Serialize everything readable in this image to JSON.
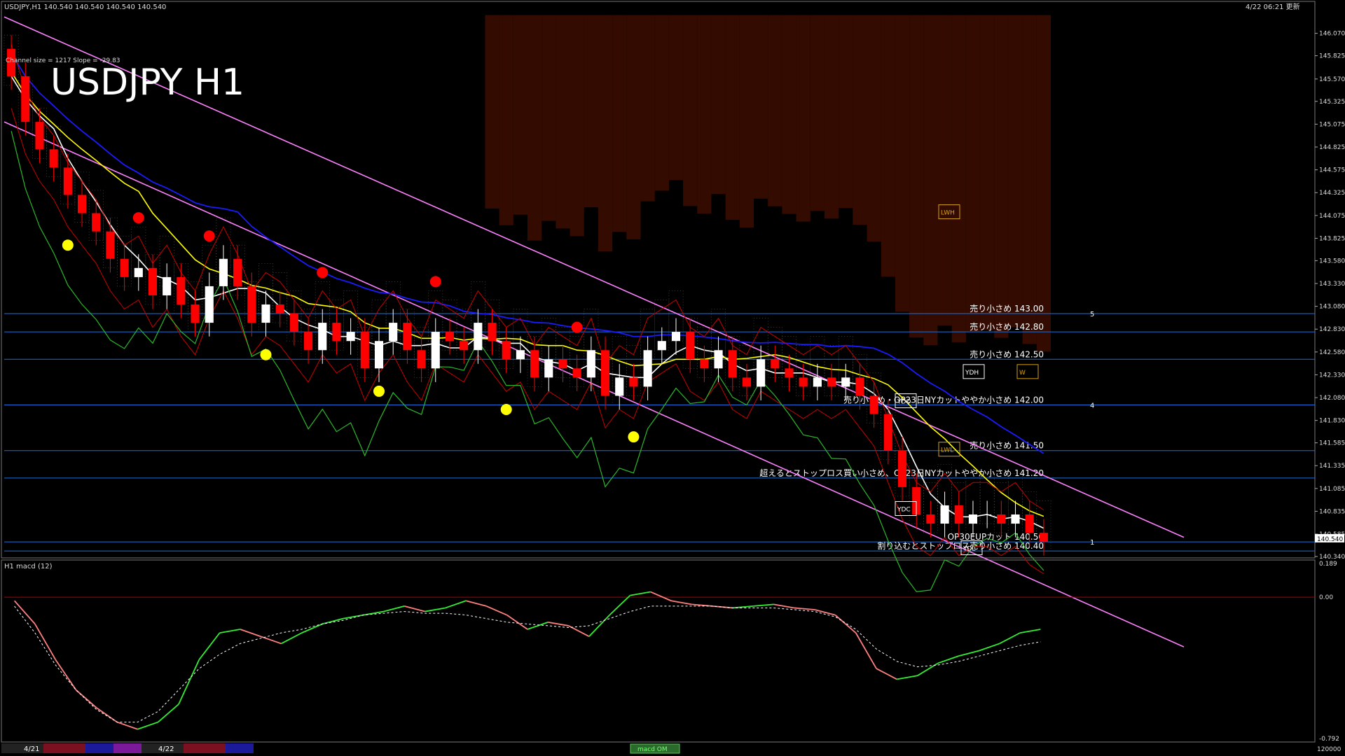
{
  "window": {
    "header_info": "USDJPY,H1  140.540 140.540 140.540 140.540",
    "timestamp": "4/22 06:21 更新",
    "channel_info": "Channel size = 1217 Slope = -29.83",
    "big_title": "USDJPY H1",
    "macd_label": "H1  macd (12)",
    "macd_button": "macd OM"
  },
  "colors": {
    "bg": "#000000",
    "bull": "#ffffff",
    "bear": "#ff0000",
    "yellow_ma": "#ffff00",
    "blue_ma": "#1a1aff",
    "white_ma": "#ffffff",
    "channel": "#ff80ff",
    "chikou": "#2bb82b",
    "bollinger": "#cc0000",
    "level_line": "#1e6fd9",
    "cloud_up": "#ff6a00",
    "cloud_dn": "#9a9a9a",
    "macd_up": "#33ee33",
    "macd_dn": "#ff8080"
  },
  "chart_data": {
    "type": "candlestick",
    "symbol": "USDJPY",
    "timeframe": "H1",
    "ylim": [
      140.34,
      146.32
    ],
    "y_ticks": [
      "146.070",
      "145.825",
      "145.570",
      "145.325",
      "145.075",
      "144.825",
      "144.575",
      "144.325",
      "144.075",
      "143.825",
      "143.580",
      "143.330",
      "143.080",
      "142.830",
      "142.580",
      "142.330",
      "142.080",
      "141.830",
      "141.585",
      "141.335",
      "141.085",
      "140.835",
      "140.585",
      "140.340"
    ],
    "price_tag": "140.540",
    "closes": [
      145.6,
      145.1,
      144.8,
      144.6,
      144.3,
      144.1,
      143.9,
      143.6,
      143.4,
      143.5,
      143.2,
      143.4,
      143.1,
      142.9,
      143.3,
      143.6,
      143.3,
      142.9,
      143.1,
      143.0,
      142.8,
      142.6,
      142.9,
      142.7,
      142.8,
      142.4,
      142.7,
      142.9,
      142.6,
      142.4,
      142.8,
      142.7,
      142.6,
      142.9,
      142.7,
      142.5,
      142.6,
      142.3,
      142.5,
      142.4,
      142.3,
      142.6,
      142.1,
      142.3,
      142.2,
      142.6,
      142.7,
      142.8,
      142.5,
      142.4,
      142.6,
      142.3,
      142.2,
      142.5,
      142.4,
      142.3,
      142.2,
      142.3,
      142.2,
      142.3,
      142.1,
      141.9,
      141.5,
      141.1,
      140.8,
      140.7,
      140.9,
      140.7,
      140.8,
      140.8,
      140.7,
      140.8,
      140.6,
      140.5
    ],
    "levels": [
      {
        "price": 143.0,
        "label": "売り小さめ 143.00",
        "marker": "5"
      },
      {
        "price": 142.8,
        "label": "売り小さめ 142.80",
        "marker": ""
      },
      {
        "price": 142.5,
        "label": "売り小さめ 142.50",
        "marker": ""
      },
      {
        "price": 142.0,
        "label": "売り小さめ・OP23日NYカットややか小さめ 142.00",
        "marker": "4"
      },
      {
        "price": 141.5,
        "label": "売り小さめ 141.50",
        "marker": ""
      },
      {
        "price": 141.2,
        "label": "超えるとストップロス買い小さめ、OP23日NYカットややか小さめ 141.20",
        "marker": ""
      },
      {
        "price": 140.5,
        "label": "OP30EUPカット 140.50",
        "marker": "1"
      },
      {
        "price": 140.4,
        "label": "割り込むとストップロス売り小さめ 140.40",
        "marker": ""
      }
    ],
    "boxes": [
      "YDO",
      "YDH",
      "W",
      "YDC",
      "YDL",
      "LWH",
      "LWL"
    ],
    "macd": {
      "ylim": [
        -0.792,
        0.189
      ],
      "y_ticks": [
        "0.189",
        "0.00",
        "-0.792"
      ],
      "main": [
        -0.02,
        -0.15,
        -0.35,
        -0.52,
        -0.62,
        -0.7,
        -0.74,
        -0.7,
        -0.6,
        -0.35,
        -0.2,
        -0.18,
        -0.22,
        -0.26,
        -0.2,
        -0.15,
        -0.12,
        -0.1,
        -0.08,
        -0.05,
        -0.08,
        -0.06,
        -0.02,
        -0.05,
        -0.1,
        -0.18,
        -0.14,
        -0.16,
        -0.22,
        -0.1,
        0.01,
        0.03,
        -0.02,
        -0.04,
        -0.05,
        -0.06,
        -0.05,
        -0.04,
        -0.06,
        -0.07,
        -0.1,
        -0.2,
        -0.4,
        -0.46,
        -0.44,
        -0.37,
        -0.33,
        -0.3,
        -0.26,
        -0.2,
        -0.18
      ],
      "signal": [
        -0.05,
        -0.2,
        -0.38,
        -0.52,
        -0.63,
        -0.7,
        -0.7,
        -0.64,
        -0.52,
        -0.4,
        -0.32,
        -0.26,
        -0.23,
        -0.2,
        -0.18,
        -0.15,
        -0.13,
        -0.1,
        -0.09,
        -0.08,
        -0.09,
        -0.09,
        -0.1,
        -0.12,
        -0.14,
        -0.15,
        -0.16,
        -0.17,
        -0.16,
        -0.12,
        -0.08,
        -0.05,
        -0.05,
        -0.05,
        -0.05,
        -0.06,
        -0.06,
        -0.06,
        -0.07,
        -0.08,
        -0.11,
        -0.18,
        -0.29,
        -0.36,
        -0.39,
        -0.38,
        -0.36,
        -0.33,
        -0.3,
        -0.27,
        -0.25
      ]
    },
    "date_labels": [
      "4/21",
      "4/22"
    ],
    "scale_bottom": "120000"
  }
}
